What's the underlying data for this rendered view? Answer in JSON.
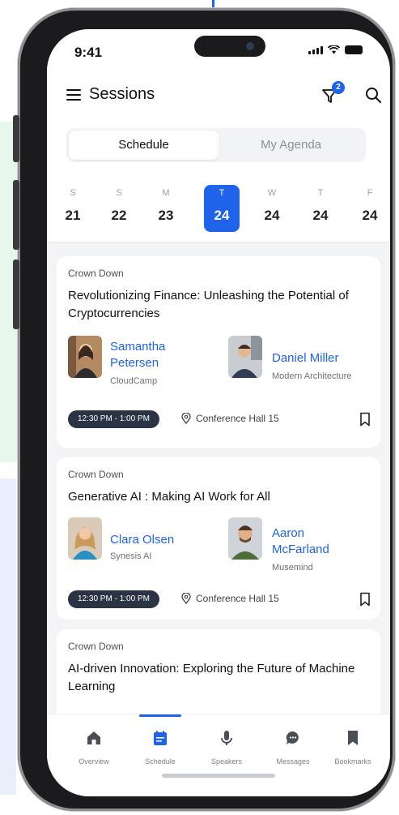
{
  "status": {
    "time": "9:41"
  },
  "header": {
    "title": "Sessions",
    "filter_count": "2"
  },
  "segments": {
    "schedule": "Schedule",
    "agenda": "My Agenda"
  },
  "week": [
    {
      "letter": "S",
      "num": "21"
    },
    {
      "letter": "S",
      "num": "22"
    },
    {
      "letter": "M",
      "num": "23"
    },
    {
      "letter": "T",
      "num": "24",
      "selected": true
    },
    {
      "letter": "W",
      "num": "24"
    },
    {
      "letter": "T",
      "num": "24"
    },
    {
      "letter": "F",
      "num": "24"
    }
  ],
  "sessions": [
    {
      "room": "Crown Down",
      "title": "Revolutionizing Finance: Unleashing the Potential of Cryptocurrencies",
      "speakers": [
        {
          "name": "Samantha Petersen",
          "company": "CloudCamp"
        },
        {
          "name": "Daniel Miller",
          "company": "Modern Architecture"
        }
      ],
      "time": "12:30 PM - 1:00 PM",
      "location": "Conference Hall 15"
    },
    {
      "room": "Crown Down",
      "title": "Generative AI : Making AI Work for All",
      "speakers": [
        {
          "name": "Clara Olsen",
          "company": "Synesis AI"
        },
        {
          "name": "Aaron McFarland",
          "company": "Musemind"
        }
      ],
      "time": "12:30 PM - 1:00 PM",
      "location": "Conference Hall 15"
    },
    {
      "room": "Crown Down",
      "title": "AI-driven Innovation: Exploring the Future of Machine Learning"
    }
  ],
  "tabs": {
    "overview": "Overview",
    "schedule": "Schedule",
    "speakers": "Speakers",
    "messages": "Messages",
    "bookmarks": "Bookmarks"
  },
  "colors": {
    "accent": "#1e63e9",
    "pill": "#2b3444",
    "background": "#f3f4f6"
  }
}
